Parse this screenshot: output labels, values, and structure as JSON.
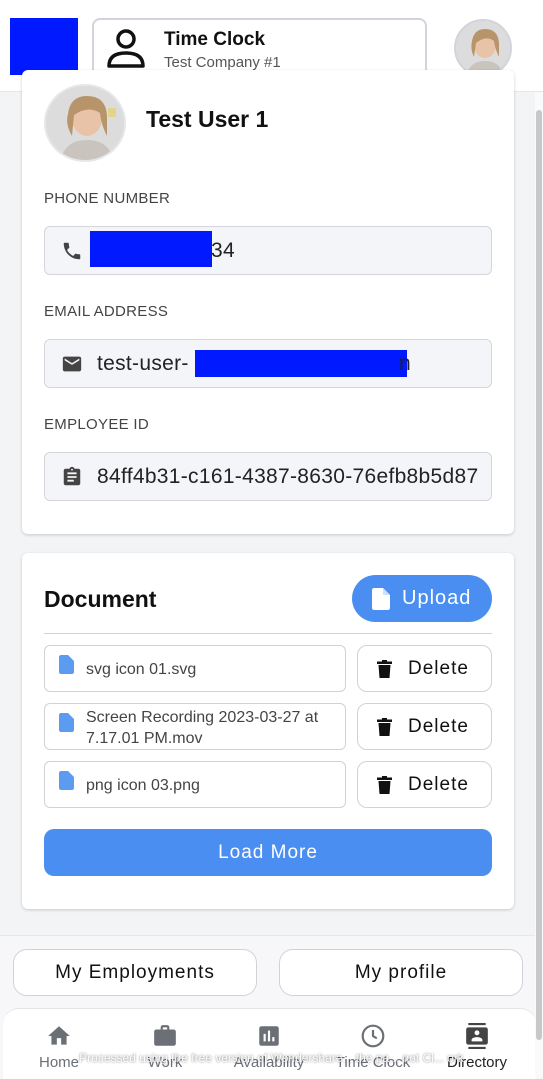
{
  "header": {
    "app_title": "Time Clock",
    "company": "Test Company #1"
  },
  "profile": {
    "user_name": "Test User 1",
    "phone_label": "PHONE NUMBER",
    "phone_visible_suffix": "34",
    "email_label": "EMAIL ADDRESS",
    "email_visible_prefix": "test-user-",
    "email_visible_suffix": "n",
    "employee_id_label": "EMPLOYEE ID",
    "employee_id": "84ff4b31-c161-4387-8630-76efb8b5d87"
  },
  "documents": {
    "title": "Document",
    "upload_label": "Upload",
    "files": [
      {
        "name": "svg icon 01.svg"
      },
      {
        "name": "Screen Recording 2023-03-27 at 7.17.01 PM.mov"
      },
      {
        "name": "png icon 03.png"
      }
    ],
    "delete_label": "Delete",
    "load_more_label": "Load More"
  },
  "actions": {
    "my_employments": "My Employments",
    "my_profile": "My profile"
  },
  "nav": {
    "items": [
      {
        "label": "Home",
        "icon": "home-icon"
      },
      {
        "label": "Work",
        "icon": "briefcase-icon"
      },
      {
        "label": "Availability",
        "icon": "bar-chart-icon"
      },
      {
        "label": "Time Clock",
        "icon": "clock-icon"
      },
      {
        "label": "Directory",
        "icon": "contacts-icon"
      }
    ],
    "active": "Directory"
  },
  "footer_note": "Processed using the free version of Wondershare... the pa... not Cl... ork",
  "colors": {
    "accent": "#4b8ef1",
    "redaction": "#0019ff"
  }
}
